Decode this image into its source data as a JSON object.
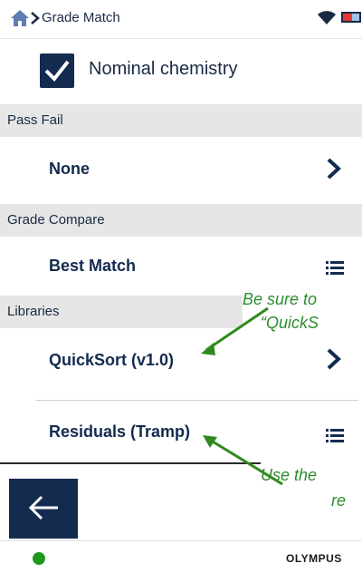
{
  "status_bar": {
    "breadcrumb_label": "Grade Match"
  },
  "nominal": {
    "label": "Nominal chemistry",
    "checked": true
  },
  "sections": {
    "pass_fail": {
      "header": "Pass Fail",
      "value": "None"
    },
    "grade_compare": {
      "header": "Grade Compare",
      "value": "Best Match"
    },
    "libraries": {
      "header": "Libraries",
      "items": [
        "QuickSort (v1.0)",
        "Residuals (Tramp)"
      ]
    }
  },
  "callouts": {
    "first": {
      "line1": "Be sure to",
      "line2": "“QuickS"
    },
    "second": {
      "line1": "Use the",
      "line2": "re"
    }
  },
  "footer": {
    "brand": "OLYMPUS"
  },
  "colors": {
    "navy": "#132b4f",
    "callout_green": "#2c8c2c",
    "status_green": "#1d9a1d"
  },
  "icons": [
    "home-icon",
    "chevron-right-icon",
    "wifi-icon",
    "battery-icon",
    "checkmark-icon",
    "list-icon",
    "back-arrow-icon"
  ]
}
